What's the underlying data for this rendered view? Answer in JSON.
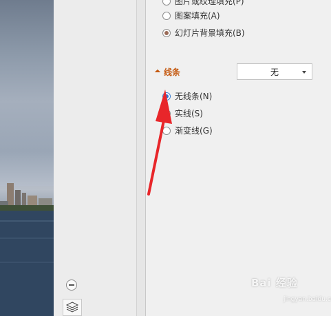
{
  "fill_options": [
    {
      "label": "图片或纹理填充(P)",
      "checked": false
    },
    {
      "label": "图案填充(A)",
      "checked": false
    },
    {
      "label": "幻灯片背景填充(B)",
      "checked": true
    }
  ],
  "line_section": {
    "title": "线条",
    "dropdown_value": "无",
    "options": [
      {
        "label": "无线条(N)",
        "checked": true
      },
      {
        "label": "实线(S)",
        "checked": false
      },
      {
        "label": "渐变线(G)",
        "checked": false
      }
    ]
  },
  "watermark": {
    "brand": "Bai 经验",
    "site": "jingyan.baidu.com"
  },
  "icons": {
    "zoom_out": "minus-circle-icon",
    "layers": "layers-icon",
    "section_toggle": "triangle-expand-icon",
    "dropdown_caret": "chevron-down-icon"
  },
  "colors": {
    "accent_orange": "#c55a11",
    "radio_checked_blue": "#2f78d6",
    "arrow_red": "#e8262a"
  }
}
